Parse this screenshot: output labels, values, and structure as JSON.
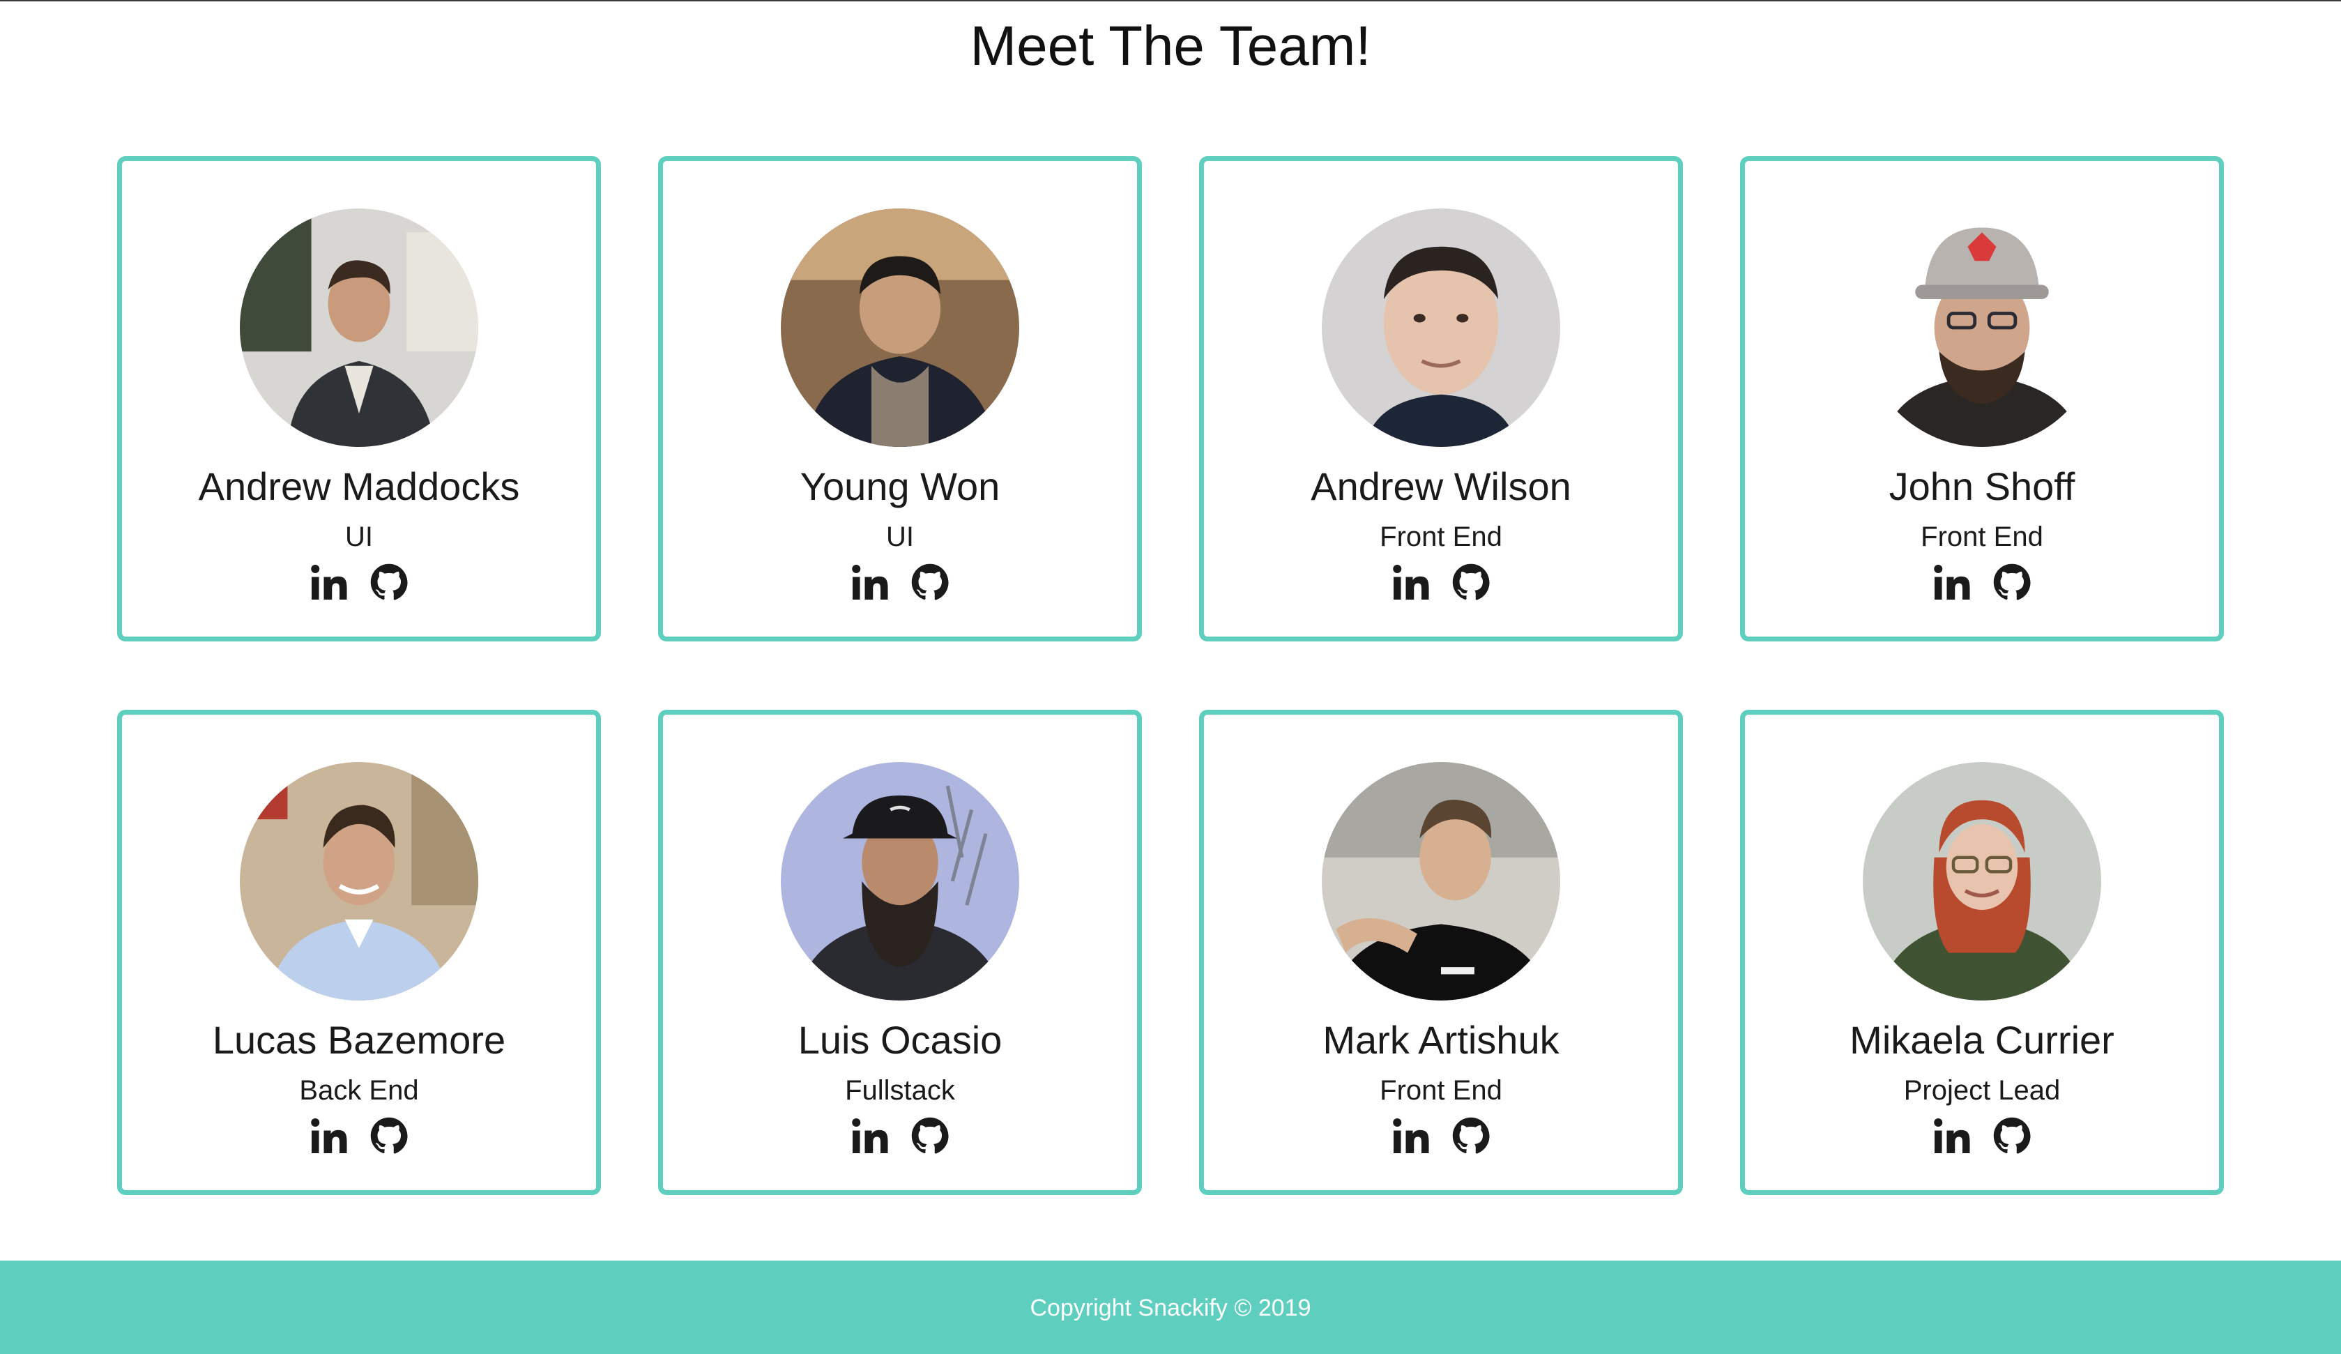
{
  "page": {
    "title": "Meet The Team!",
    "accent_color": "#5ecfbe"
  },
  "members": [
    {
      "name": "Andrew Maddocks",
      "role": "UI",
      "photo": "photo-man-in-suit",
      "links": [
        "linkedin-icon",
        "github-icon"
      ]
    },
    {
      "name": "Young Won",
      "role": "UI",
      "photo": "photo-man-in-dark-jacket",
      "links": [
        "linkedin-icon",
        "github-icon"
      ]
    },
    {
      "name": "Andrew Wilson",
      "role": "Front End",
      "photo": "photo-man-grey-background",
      "links": [
        "linkedin-icon",
        "github-icon"
      ]
    },
    {
      "name": "John Shoff",
      "role": "Front End",
      "photo": "photo-man-with-cap-and-glasses",
      "links": [
        "linkedin-icon",
        "github-icon"
      ]
    },
    {
      "name": "Lucas Bazemore",
      "role": "Back End",
      "photo": "photo-man-in-blue-shirt",
      "links": [
        "linkedin-icon",
        "github-icon"
      ]
    },
    {
      "name": "Luis Ocasio",
      "role": "Fullstack",
      "photo": "photo-man-with-beard-and-cap",
      "links": [
        "linkedin-icon",
        "github-icon"
      ]
    },
    {
      "name": "Mark Artishuk",
      "role": "Front End",
      "photo": "photo-man-outdoors",
      "links": [
        "linkedin-icon",
        "github-icon"
      ]
    },
    {
      "name": "Mikaela Currier",
      "role": "Project Lead",
      "photo": "photo-woman-in-green",
      "links": [
        "linkedin-icon",
        "github-icon"
      ]
    }
  ],
  "footer": {
    "copyright": "Copyright Snackify © 2019"
  }
}
